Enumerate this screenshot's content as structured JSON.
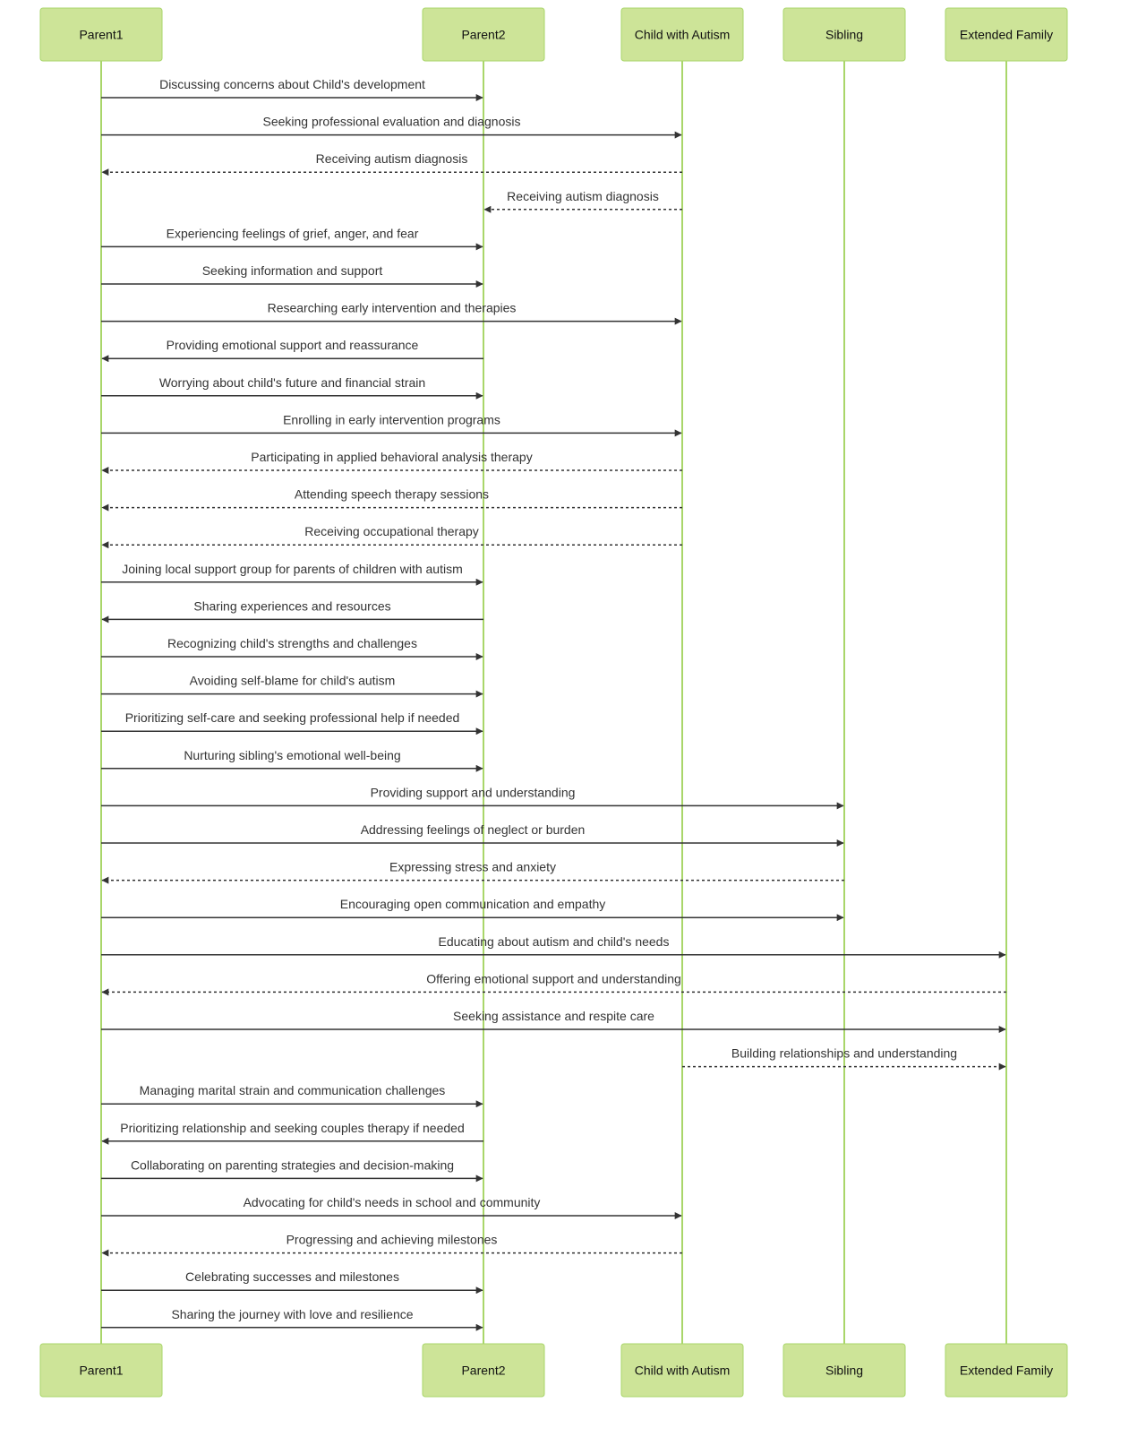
{
  "diagram": {
    "type": "sequence",
    "colors": {
      "actor_fill": "#cde498",
      "actor_border": "#a9d66a",
      "lifeline": "#a9d66a",
      "message": "#333333"
    },
    "actors": [
      {
        "id": "P1",
        "label": "Parent1"
      },
      {
        "id": "P2",
        "label": "Parent2"
      },
      {
        "id": "C",
        "label": "Child with Autism"
      },
      {
        "id": "S",
        "label": "Sibling"
      },
      {
        "id": "E",
        "label": "Extended Family"
      }
    ],
    "messages": [
      {
        "from": "P1",
        "to": "P2",
        "style": "solid",
        "text": "Discussing concerns about Child's development"
      },
      {
        "from": "P1",
        "to": "C",
        "style": "solid",
        "text": "Seeking professional evaluation and diagnosis"
      },
      {
        "from": "C",
        "to": "P1",
        "style": "dashed",
        "text": "Receiving autism diagnosis"
      },
      {
        "from": "C",
        "to": "P2",
        "style": "dashed",
        "text": "Receiving autism diagnosis"
      },
      {
        "from": "P1",
        "to": "P2",
        "style": "solid",
        "text": "Experiencing feelings of grief, anger, and fear"
      },
      {
        "from": "P1",
        "to": "P2",
        "style": "solid",
        "text": "Seeking information and support"
      },
      {
        "from": "P1",
        "to": "C",
        "style": "solid",
        "text": "Researching early intervention and therapies"
      },
      {
        "from": "P2",
        "to": "P1",
        "style": "solid",
        "text": "Providing emotional support and reassurance"
      },
      {
        "from": "P1",
        "to": "P2",
        "style": "solid",
        "text": "Worrying about child's future and financial strain"
      },
      {
        "from": "P1",
        "to": "C",
        "style": "solid",
        "text": "Enrolling in early intervention programs"
      },
      {
        "from": "C",
        "to": "P1",
        "style": "dashed",
        "text": "Participating in applied behavioral analysis therapy"
      },
      {
        "from": "C",
        "to": "P1",
        "style": "dashed",
        "text": "Attending speech therapy sessions"
      },
      {
        "from": "C",
        "to": "P1",
        "style": "dashed",
        "text": "Receiving occupational therapy"
      },
      {
        "from": "P1",
        "to": "P2",
        "style": "solid",
        "text": "Joining local support group for parents of children with autism"
      },
      {
        "from": "P2",
        "to": "P1",
        "style": "solid",
        "text": "Sharing experiences and resources"
      },
      {
        "from": "P1",
        "to": "P2",
        "style": "solid",
        "text": "Recognizing child's strengths and challenges"
      },
      {
        "from": "P1",
        "to": "P2",
        "style": "solid",
        "text": "Avoiding self-blame for child's autism"
      },
      {
        "from": "P1",
        "to": "P2",
        "style": "solid",
        "text": "Prioritizing self-care and seeking professional help if needed"
      },
      {
        "from": "P1",
        "to": "P2",
        "style": "solid",
        "text": "Nurturing sibling's emotional well-being"
      },
      {
        "from": "P1",
        "to": "S",
        "style": "solid",
        "text": "Providing support and understanding"
      },
      {
        "from": "P1",
        "to": "S",
        "style": "solid",
        "text": "Addressing feelings of neglect or burden"
      },
      {
        "from": "S",
        "to": "P1",
        "style": "dashed",
        "text": "Expressing stress and anxiety"
      },
      {
        "from": "P1",
        "to": "S",
        "style": "solid",
        "text": "Encouraging open communication and empathy"
      },
      {
        "from": "P1",
        "to": "E",
        "style": "solid",
        "text": "Educating about autism and child's needs"
      },
      {
        "from": "E",
        "to": "P1",
        "style": "dashed",
        "text": "Offering emotional support and understanding"
      },
      {
        "from": "P1",
        "to": "E",
        "style": "solid",
        "text": "Seeking assistance and respite care"
      },
      {
        "from": "C",
        "to": "E",
        "style": "dashed",
        "text": "Building relationships and understanding"
      },
      {
        "from": "P1",
        "to": "P2",
        "style": "solid",
        "text": "Managing marital strain and communication challenges"
      },
      {
        "from": "P2",
        "to": "P1",
        "style": "solid",
        "text": "Prioritizing relationship and seeking couples therapy if needed"
      },
      {
        "from": "P1",
        "to": "P2",
        "style": "solid",
        "text": "Collaborating on parenting strategies and decision-making"
      },
      {
        "from": "P1",
        "to": "C",
        "style": "solid",
        "text": "Advocating for child's needs in school and community"
      },
      {
        "from": "C",
        "to": "P1",
        "style": "dashed",
        "text": "Progressing and achieving milestones"
      },
      {
        "from": "P1",
        "to": "P2",
        "style": "solid",
        "text": "Celebrating successes and milestones"
      },
      {
        "from": "P1",
        "to": "P2",
        "style": "solid",
        "text": "Sharing the journey with love and resilience"
      }
    ]
  }
}
